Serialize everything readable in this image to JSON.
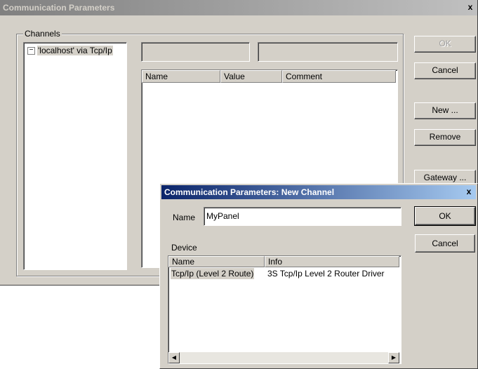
{
  "main_dialog": {
    "title": "Communication Parameters",
    "close_label": "x",
    "channels_label": "Channels",
    "tree_expander": "−",
    "tree_item": "'localhost' via Tcp/Ip",
    "field1_value": "",
    "field2_value": "",
    "columns": [
      "Name",
      "Value",
      "Comment"
    ],
    "buttons": {
      "ok": "OK",
      "cancel": "Cancel",
      "new": "New ...",
      "remove": "Remove",
      "gateway": "Gateway ..."
    }
  },
  "new_channel_dialog": {
    "title": "Communication Parameters: New Channel",
    "close_label": "x",
    "name_label": "Name",
    "name_value": "MyPanel",
    "device_label": "Device",
    "columns": [
      "Name",
      "Info"
    ],
    "rows": [
      {
        "name": "Tcp/Ip (Level 2 Route)",
        "info": "3S Tcp/Ip Level 2 Router Driver"
      }
    ],
    "buttons": {
      "ok": "OK",
      "cancel": "Cancel"
    },
    "scroll_left": "◀",
    "scroll_right": "▶"
  }
}
